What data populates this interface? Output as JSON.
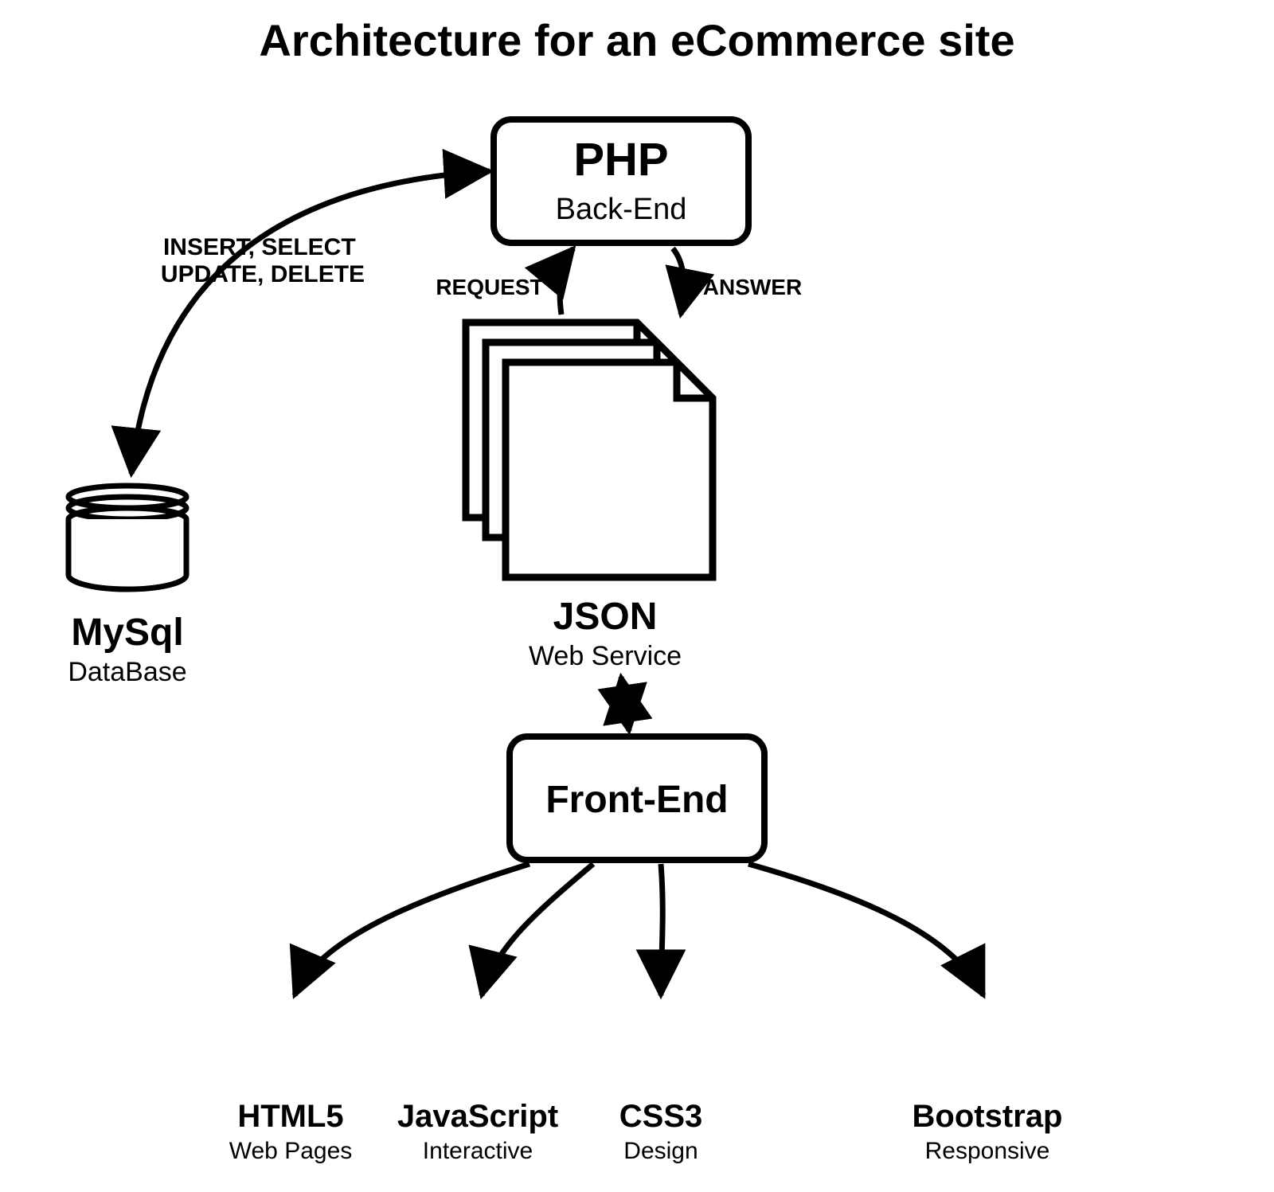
{
  "nodes": {
    "title": {
      "label": "Architecture for an eCommerce site"
    },
    "php": {
      "label": "PHP",
      "sub": "Back-End"
    },
    "mysql": {
      "label": "MySql",
      "sub": "DataBase"
    },
    "json": {
      "label": "JSON",
      "sub": "Web Service"
    },
    "frontend": {
      "label": "Front-End"
    },
    "html": {
      "label": "HTML5",
      "sub": "Web Pages"
    },
    "js": {
      "label": "JavaScript",
      "sub": "Interactive"
    },
    "css": {
      "label": "CSS3",
      "sub": "Design"
    },
    "bootstrap": {
      "label": "Bootstrap",
      "sub": "Responsive"
    }
  },
  "edges": {
    "php_mysql": "INSERT, SELECT\nUPDATE, DELETE",
    "json_php": "REQUEST",
    "php_json": "ANSWER",
    "json_fe": "",
    "fe_html": "",
    "fe_js": "",
    "fe_css": "",
    "fe_bootstrap": ""
  }
}
